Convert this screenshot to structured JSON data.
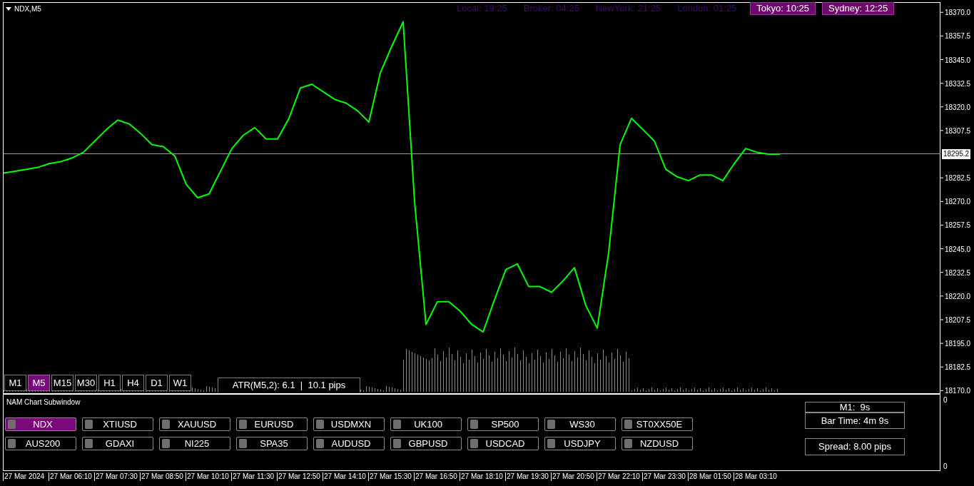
{
  "chart": {
    "symbol": "NDX,M5",
    "clocks": [
      {
        "label": "Local: 19:25",
        "active": false
      },
      {
        "label": "Broker: 04:25",
        "active": false
      },
      {
        "label": "NewYork: 21:25",
        "active": false
      },
      {
        "label": "London: 01:25",
        "active": false
      },
      {
        "label": "Tokyo: 10:25",
        "active": true
      },
      {
        "label": "Sydney: 12:25",
        "active": true
      }
    ],
    "timeframes": [
      {
        "label": "M1",
        "selected": false
      },
      {
        "label": "M5",
        "selected": true
      },
      {
        "label": "M15",
        "selected": false
      },
      {
        "label": "M30",
        "selected": false
      },
      {
        "label": "H1",
        "selected": false
      },
      {
        "label": "H4",
        "selected": false
      },
      {
        "label": "D1",
        "selected": false
      },
      {
        "label": "W1",
        "selected": false
      }
    ],
    "atr": "ATR(M5,2): 6.1  |  10.1 pips",
    "chart_data": {
      "type": "line",
      "categories": [
        null,
        null,
        null,
        null,
        null,
        null,
        null,
        null,
        null,
        null,
        null,
        null,
        null,
        null,
        null,
        null,
        null,
        null,
        null,
        null,
        null,
        null,
        null,
        null,
        null,
        null,
        null,
        null,
        null,
        null,
        null,
        null,
        null,
        null,
        null,
        null,
        null,
        null,
        null,
        null,
        null,
        null,
        null,
        null,
        null,
        null,
        null,
        null,
        null,
        null,
        null,
        null,
        null,
        null,
        null,
        null,
        null,
        null,
        null,
        null,
        null,
        null,
        null,
        null,
        null,
        null,
        null,
        null,
        null
      ],
      "series": [
        {
          "color": "#00ff00",
          "values": [
            18285,
            18286,
            18287,
            18288,
            18290,
            18291,
            18293,
            18296,
            18302,
            18308,
            18313,
            18311,
            18306,
            18300,
            18299,
            18294,
            18279,
            18272,
            18274,
            18286,
            18298,
            18305,
            18309,
            18303,
            18303,
            18314,
            18330,
            18332,
            18328,
            18324,
            18322,
            18318,
            18312,
            18338,
            18352,
            18365,
            18270,
            18205,
            18217,
            18217,
            18212,
            18205,
            18201,
            18218,
            18234,
            18237,
            18225,
            18225,
            18222,
            18228,
            18235,
            18215,
            18203,
            18243,
            18300,
            18314,
            18308,
            18302,
            18287,
            18283,
            18281,
            18284,
            18284,
            18281,
            18290,
            18298,
            18296,
            18295,
            18295
          ]
        }
      ],
      "ylim": [
        18169,
        18375
      ],
      "ref_lines": [
        {
          "axis": "y",
          "value": 18295.2
        }
      ],
      "yticks": [
        {
          "value": 18370,
          "label": "18370.0"
        },
        {
          "value": 18357.5,
          "label": "18357.5"
        },
        {
          "value": 18345,
          "label": "18345.0"
        },
        {
          "value": 18332.5,
          "label": "18332.5"
        },
        {
          "value": 18320,
          "label": "18320.0"
        },
        {
          "value": 18307.5,
          "label": "18307.5"
        },
        {
          "value": 18282.5,
          "label": "18282.5"
        },
        {
          "value": 18270,
          "label": "18270.0"
        },
        {
          "value": 18257.5,
          "label": "18257.5"
        },
        {
          "value": 18245,
          "label": "18245.0"
        },
        {
          "value": 18232.5,
          "label": "18232.5"
        },
        {
          "value": 18220,
          "label": "18220.0"
        },
        {
          "value": 18207.5,
          "label": "18207.5"
        },
        {
          "value": 18195,
          "label": "18195.0"
        },
        {
          "value": 18182.5,
          "label": "18182.5"
        },
        {
          "value": 18170,
          "label": "18170.0"
        }
      ]
    },
    "current_price": "18295.2"
  },
  "time_axis": [
    "27 Mar 2024",
    "27 Mar 06:10",
    "27 Mar 07:30",
    "27 Mar 08:50",
    "27 Mar 10:10",
    "27 Mar 11:30",
    "27 Mar 12:50",
    "27 Mar 14:10",
    "27 Mar 15:30",
    "27 Mar 16:50",
    "27 Mar 18:10",
    "27 Mar 19:30",
    "27 Mar 20:50",
    "27 Mar 22:10",
    "27 Mar 23:30",
    "28 Mar 01:50",
    "28 Mar 03:10"
  ],
  "subwindow": {
    "title": "NAM Chart Subwindow",
    "symbols": [
      {
        "label": "NDX",
        "selected": true
      },
      {
        "label": "XTIUSD",
        "selected": false
      },
      {
        "label": "XAUUSD",
        "selected": false
      },
      {
        "label": "EURUSD",
        "selected": false
      },
      {
        "label": "USDMXN",
        "selected": false
      },
      {
        "label": "UK100",
        "selected": false
      },
      {
        "label": "SP500",
        "selected": false
      },
      {
        "label": "WS30",
        "selected": false
      },
      {
        "label": "ST0XX50E",
        "selected": false
      },
      {
        "label": "AUS200",
        "selected": false
      },
      {
        "label": "GDAXI",
        "selected": false
      },
      {
        "label": "NI225",
        "selected": false
      },
      {
        "label": "SPA35",
        "selected": false
      },
      {
        "label": "AUDUSD",
        "selected": false
      },
      {
        "label": "GBPUSD",
        "selected": false
      },
      {
        "label": "USDCAD",
        "selected": false
      },
      {
        "label": "USDJPY",
        "selected": false
      },
      {
        "label": "NZDUSD",
        "selected": false
      }
    ],
    "timer": "M1:  9s",
    "bar_time": "Bar Time: 4m 9s",
    "spread": "Spread: 8.00 pips",
    "axis_labels": [
      "0",
      "0"
    ]
  }
}
